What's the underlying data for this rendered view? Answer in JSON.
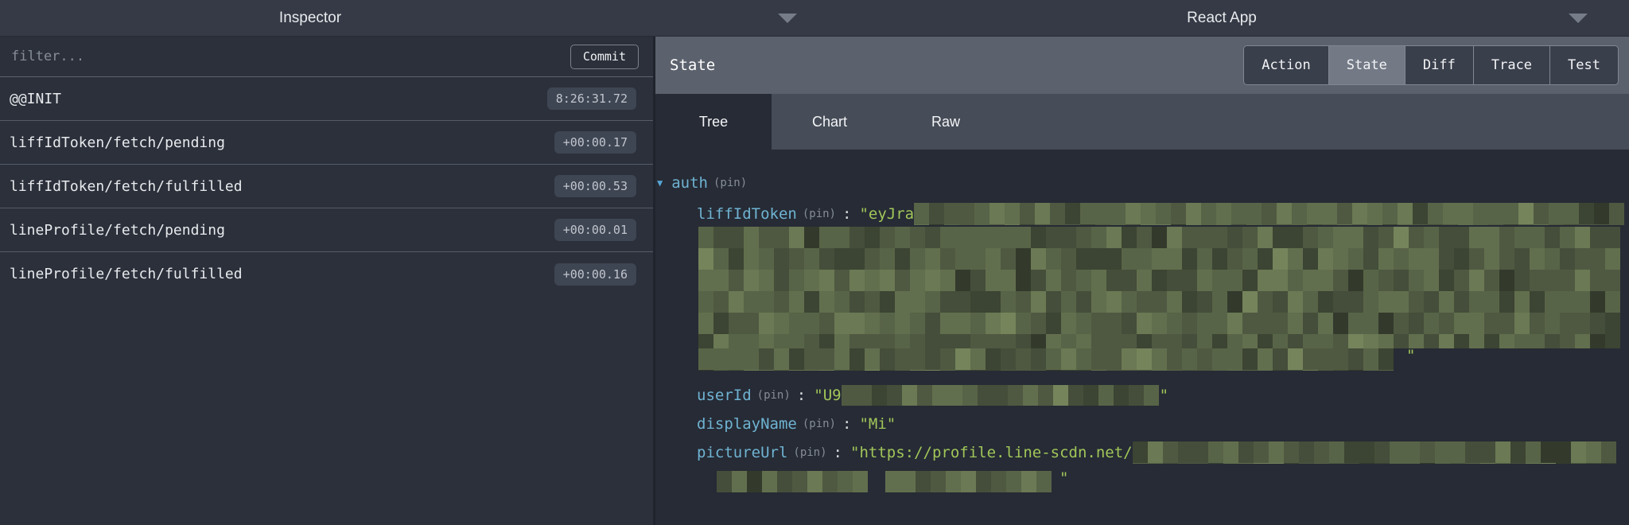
{
  "topbar": {
    "left_title": "Inspector",
    "right_title": "React App"
  },
  "inspector": {
    "filter_placeholder": "filter...",
    "commit_label": "Commit",
    "actions": [
      {
        "label": "@@INIT",
        "time": "8:26:31.72"
      },
      {
        "label": "liffIdToken/fetch/pending",
        "time": "+00:00.17"
      },
      {
        "label": "liffIdToken/fetch/fulfilled",
        "time": "+00:00.53"
      },
      {
        "label": "lineProfile/fetch/pending",
        "time": "+00:00.01"
      },
      {
        "label": "lineProfile/fetch/fulfilled",
        "time": "+00:00.16"
      }
    ]
  },
  "devtools": {
    "section_title": "State",
    "selected_mode": "State",
    "mode_tabs": [
      {
        "label": "Action"
      },
      {
        "label": "State"
      },
      {
        "label": "Diff"
      },
      {
        "label": "Trace"
      },
      {
        "label": "Test"
      }
    ],
    "selected_view": "Tree",
    "view_tabs": [
      {
        "label": "Tree"
      },
      {
        "label": "Chart"
      },
      {
        "label": "Raw"
      }
    ],
    "tree": {
      "root_key": "auth",
      "pin_label": "(pin)",
      "colon": ":",
      "entries": [
        {
          "key": "liffIdToken",
          "value_visible": "\"eyJra",
          "value_end": "\"",
          "redacted": true
        },
        {
          "key": "userId",
          "value_visible": "\"U9",
          "value_end": "\"",
          "redacted": true
        },
        {
          "key": "displayName",
          "value_visible": "\"Mi\"",
          "value_end": "",
          "redacted": false
        },
        {
          "key": "pictureUrl",
          "value_visible": "\"https://profile.line-scdn.net/",
          "value_end": "\"",
          "redacted": true
        }
      ]
    }
  },
  "icons": {
    "expand_arrow": "▼"
  },
  "colors": {
    "topbar_bg": "#353a46",
    "left_panel_bg": "#2b303b",
    "content_bg": "#262b35",
    "state_header_bg": "#5c626d",
    "view_tabs_bg": "#464d58",
    "time_badge_bg": "#3f4653",
    "selected_mode_bg": "#737a86",
    "mode_btn_bg": "#393f4b",
    "key_color": "#6fb3d2",
    "string_color": "#a1c659",
    "pin_color": "#868d98",
    "redaction_palette": [
      "#333a2c",
      "#3c4433",
      "#454e3a",
      "#4f5941",
      "#586447",
      "#626f4e",
      "#6b7954",
      "#75845b"
    ]
  }
}
